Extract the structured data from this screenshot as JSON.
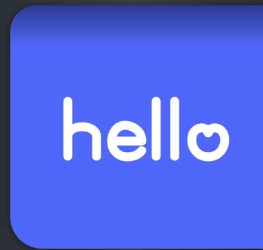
{
  "app_icon": {
    "wordmark_text": "hello",
    "background_color": "#5068F8",
    "wordmark_color": "#FFFFFF",
    "logo_detail": "heart-shaped-o"
  }
}
